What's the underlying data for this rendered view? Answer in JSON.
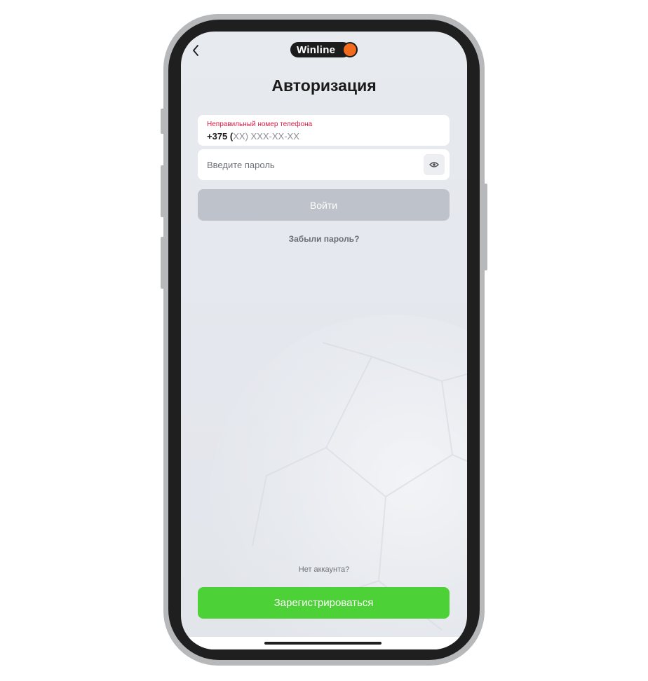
{
  "header": {
    "back_icon": "chevron-left-icon",
    "logo_text": "Winline",
    "logo_dot_color": "#f26a1b"
  },
  "title": "Авторизация",
  "phone_field": {
    "error": "Неправильный номер телефона",
    "country_code": "+375 (",
    "mask": "XX) XXX-XX-XX"
  },
  "password_field": {
    "placeholder": "Введите пароль",
    "toggle_icon": "eye-icon"
  },
  "login_button": "Войти",
  "forgot_password": "Забыли пароль?",
  "no_account": "Нет аккаунта?",
  "register_button": "Зарегистрироваться",
  "colors": {
    "error": "#d81b45",
    "register": "#4cd137",
    "login_disabled": "#bec2ca"
  }
}
